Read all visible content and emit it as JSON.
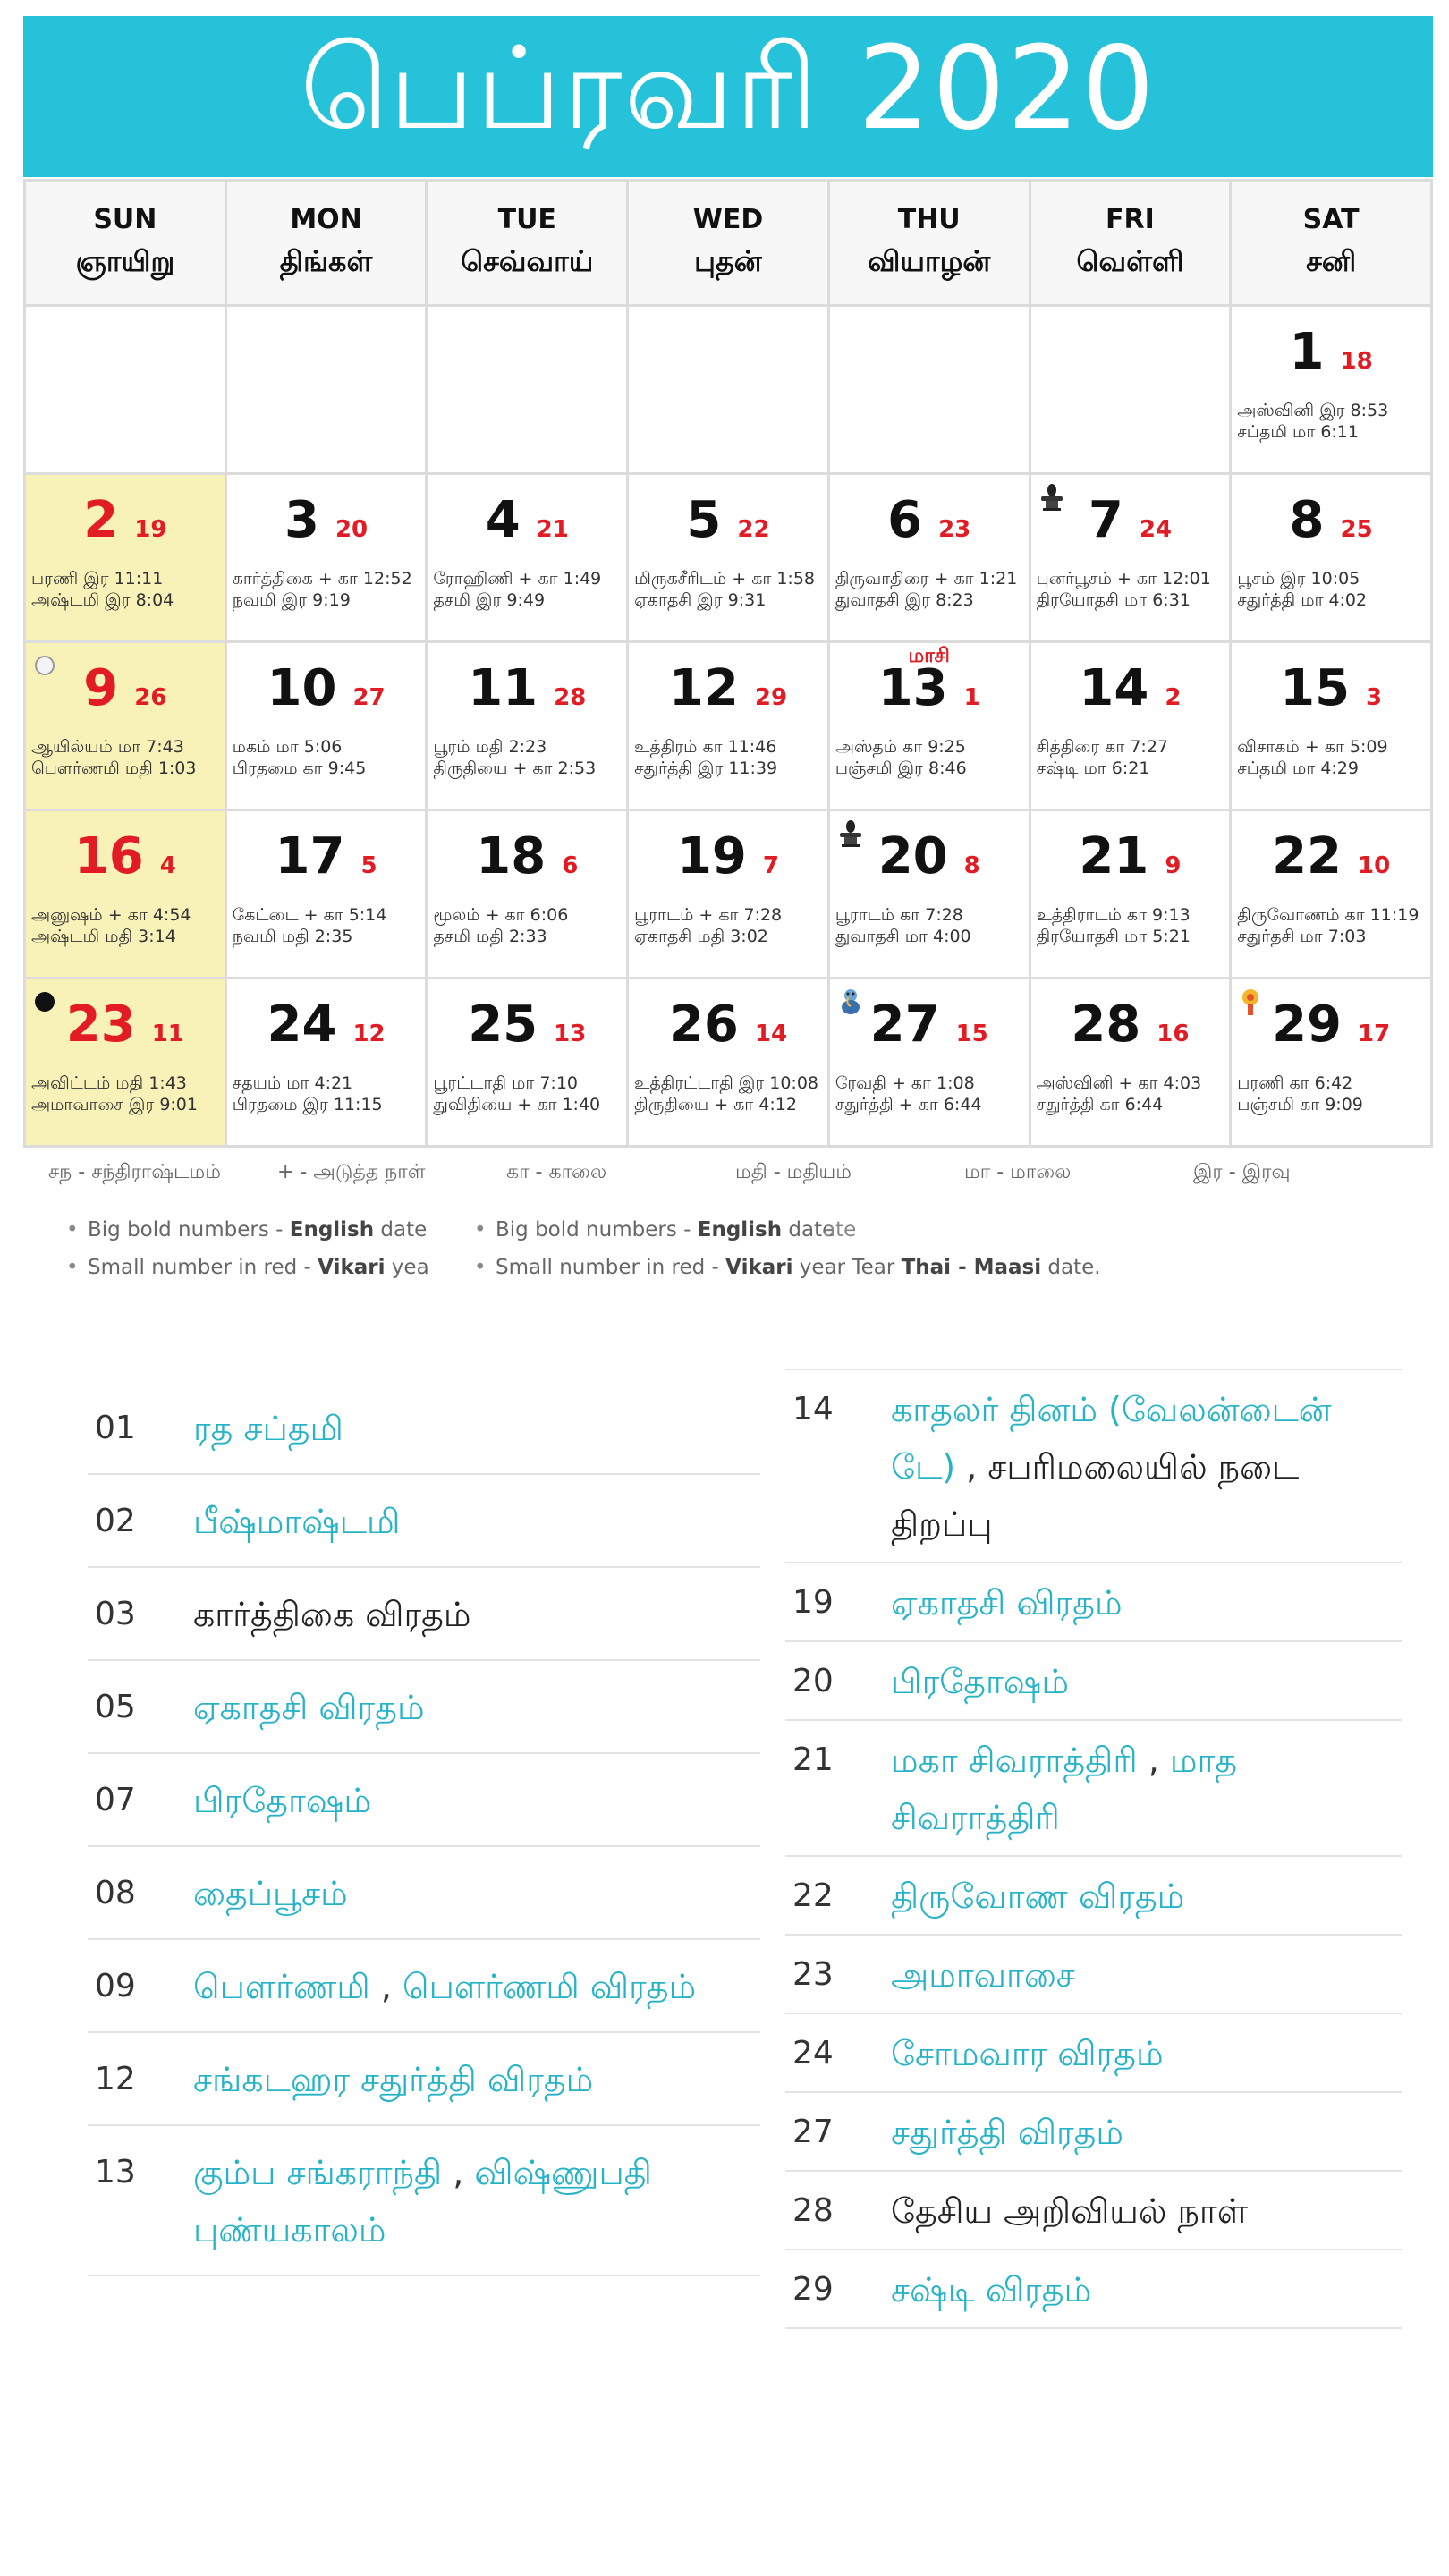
{
  "title": "பெப்ரவரி 2020",
  "weekdays": [
    {
      "en": "SUN",
      "ta": "ஞாயிறு"
    },
    {
      "en": "MON",
      "ta": "திங்கள்"
    },
    {
      "en": "TUE",
      "ta": "செவ்வாய்"
    },
    {
      "en": "WED",
      "ta": "புதன்"
    },
    {
      "en": "THU",
      "ta": "வியாழன்"
    },
    {
      "en": "FRI",
      "ta": "வெள்ளி"
    },
    {
      "en": "SAT",
      "ta": "சனி"
    }
  ],
  "days": {
    "d1": {
      "big": "1",
      "small": "18",
      "l1": "அஸ்வினி இர 8:53",
      "l2": "சப்தமி மா 6:11"
    },
    "d2": {
      "big": "2",
      "small": "19",
      "l1": "பரணி இர 11:11",
      "l2": "அஷ்டமி இர 8:04"
    },
    "d3": {
      "big": "3",
      "small": "20",
      "l1": "கார்த்திகை + கா 12:52",
      "l2": "நவமி இர 9:19"
    },
    "d4": {
      "big": "4",
      "small": "21",
      "l1": "ரோஹிணி + கா 1:49",
      "l2": "தசமி இர 9:49"
    },
    "d5": {
      "big": "5",
      "small": "22",
      "l1": "மிருகசீரிடம் + கா 1:58",
      "l2": "ஏகாதசி இர 9:31"
    },
    "d6": {
      "big": "6",
      "small": "23",
      "l1": "திருவாதிரை + கா 1:21",
      "l2": "துவாதசி இர 8:23"
    },
    "d7": {
      "big": "7",
      "small": "24",
      "l1": "புனர்பூசம் + கா 12:01",
      "l2": "திரயோதசி மா 6:31"
    },
    "d8": {
      "big": "8",
      "small": "25",
      "l1": "பூசம் இர 10:05",
      "l2": "சதுர்த்தி மா 4:02"
    },
    "d9": {
      "big": "9",
      "small": "26",
      "l1": "ஆயில்யம் மா 7:43",
      "l2": "பௌர்ணமி மதி 1:03"
    },
    "d10": {
      "big": "10",
      "small": "27",
      "l1": "மகம் மா 5:06",
      "l2": "பிரதமை கா 9:45"
    },
    "d11": {
      "big": "11",
      "small": "28",
      "l1": "பூரம் மதி 2:23",
      "l2": "திருதியை + கா 2:53"
    },
    "d12": {
      "big": "12",
      "small": "29",
      "l1": "உத்திரம் கா 11:46",
      "l2": "சதுர்த்தி இர 11:39"
    },
    "d13": {
      "big": "13",
      "small": "1",
      "tag": "மாசி",
      "l1": "அஸ்தம் கா 9:25",
      "l2": "பஞ்சமி இர 8:46"
    },
    "d14": {
      "big": "14",
      "small": "2",
      "l1": "சித்திரை கா 7:27",
      "l2": "சஷ்டி மா 6:21"
    },
    "d15": {
      "big": "15",
      "small": "3",
      "l1": "விசாகம் + கா 5:09",
      "l2": "சப்தமி மா 4:29"
    },
    "d16": {
      "big": "16",
      "small": "4",
      "l1": "அனுஷம் + கா 4:54",
      "l2": "அஷ்டமி மதி 3:14"
    },
    "d17": {
      "big": "17",
      "small": "5",
      "l1": "கேட்டை + கா 5:14",
      "l2": "நவமி மதி 2:35"
    },
    "d18": {
      "big": "18",
      "small": "6",
      "l1": "மூலம் + கா 6:06",
      "l2": "தசமி மதி 2:33"
    },
    "d19": {
      "big": "19",
      "small": "7",
      "l1": "பூராடம் + கா 7:28",
      "l2": "ஏகாதசி மதி 3:02"
    },
    "d20": {
      "big": "20",
      "small": "8",
      "l1": "பூராடம் கா 7:28",
      "l2": "துவாதசி மா 4:00"
    },
    "d21": {
      "big": "21",
      "small": "9",
      "l1": "உத்திராடம் கா 9:13",
      "l2": "திரயோதசி மா 5:21"
    },
    "d22": {
      "big": "22",
      "small": "10",
      "l1": "திருவோணம் கா 11:19",
      "l2": "சதுர்தசி மா 7:03"
    },
    "d23": {
      "big": "23",
      "small": "11",
      "l1": "அவிட்டம் மதி 1:43",
      "l2": "அமாவாசை இர 9:01"
    },
    "d24": {
      "big": "24",
      "small": "12",
      "l1": "சதயம் மா 4:21",
      "l2": "பிரதமை இர 11:15"
    },
    "d25": {
      "big": "25",
      "small": "13",
      "l1": "பூரட்டாதி மா 7:10",
      "l2": "துவிதியை + கா 1:40"
    },
    "d26": {
      "big": "26",
      "small": "14",
      "l1": "உத்திரட்டாதி இர 10:08",
      "l2": "திருதியை + கா 4:12"
    },
    "d27": {
      "big": "27",
      "small": "15",
      "l1": "ரேவதி + கா 1:08",
      "l2": "சதுர்த்தி + கா 6:44"
    },
    "d28": {
      "big": "28",
      "small": "16",
      "l1": "அஸ்வினி + கா 4:03",
      "l2": "சதுர்த்தி கா 6:44"
    },
    "d29": {
      "big": "29",
      "small": "17",
      "l1": "பரணி கா 6:42",
      "l2": "பஞ்சமி கா 9:09"
    }
  },
  "icons": {
    "d7": "shiva-lingam-icon",
    "d9": "full-moon-icon",
    "d20": "shiva-lingam-icon",
    "d23": "new-moon-icon",
    "d27": "ganesha-icon",
    "d29": "sun-god-icon"
  },
  "legend": [
    "சந - சந்திராஷ்டமம்",
    "+ - அடுத்த நாள்",
    "கா - காலை",
    "மதி - மதியம்",
    "மா - மாலை",
    "இர - இரவு"
  ],
  "notes": {
    "n1_text": "Big bold numbers - ",
    "n1_bold": "English",
    "n1_tail": " date",
    "n1_overlap": "ate",
    "n2_text": "Small number in red - ",
    "n2_bold": "Vikari",
    "n2_tail": " year T",
    "n2b_text": "Small number in red - ",
    "n2b_bold": "Vikari",
    "n2b_mid": " year T",
    "n2b_overlap": "ear ",
    "n2b_bold2": "Thai - Maasi",
    "n2b_tail": " date."
  },
  "events_left": [
    {
      "num": "01",
      "a": "ரத சப்தமி"
    },
    {
      "num": "02",
      "a": "பீஷ்மாஷ்டமி"
    },
    {
      "num": "03",
      "plain": "கார்த்திகை விரதம்"
    },
    {
      "num": "05",
      "a": "ஏகாதசி விரதம்"
    },
    {
      "num": "07",
      "a": "பிரதோஷம்"
    },
    {
      "num": "08",
      "a": "தைப்பூசம்"
    },
    {
      "num": "09",
      "a": "பௌர்ணமி",
      "sep": " , ",
      "b": "பௌர்ணமி விரதம்"
    },
    {
      "num": "12",
      "a": "சங்கடஹர சதுர்த்தி விரதம்"
    },
    {
      "num": "13",
      "a": "கும்ப சங்கராந்தி",
      "sep": " , ",
      "b": "விஷ்ணுபதி புண்யகாலம்"
    }
  ],
  "events_right": [
    {
      "num": "14",
      "a": "காதலர் தினம் (வேலன்டைன் டே)",
      "sep": " , ",
      "plain_after": "சபரிமலையில் நடை திறப்பு"
    },
    {
      "num": "19",
      "a": "ஏகாதசி விரதம்"
    },
    {
      "num": "20",
      "a": "பிரதோஷம்"
    },
    {
      "num": "21",
      "a": "மகா சிவராத்திரி",
      "sep": " , ",
      "b": "மாத சிவராத்திரி"
    },
    {
      "num": "22",
      "a": "திருவோண விரதம்"
    },
    {
      "num": "23",
      "a": "அமாவாசை"
    },
    {
      "num": "24",
      "a": "சோமவார விரதம்"
    },
    {
      "num": "27",
      "a": "சதுர்த்தி விரதம்"
    },
    {
      "num": "28",
      "plain": "தேசிய அறிவியல் நாள்"
    },
    {
      "num": "29",
      "a": "சஷ்டி விரதம்"
    }
  ],
  "colors": {
    "banner": "#26c2d9",
    "sunday": "#f8f2b9",
    "red": "#e21c24",
    "link": "#26b3c8"
  }
}
